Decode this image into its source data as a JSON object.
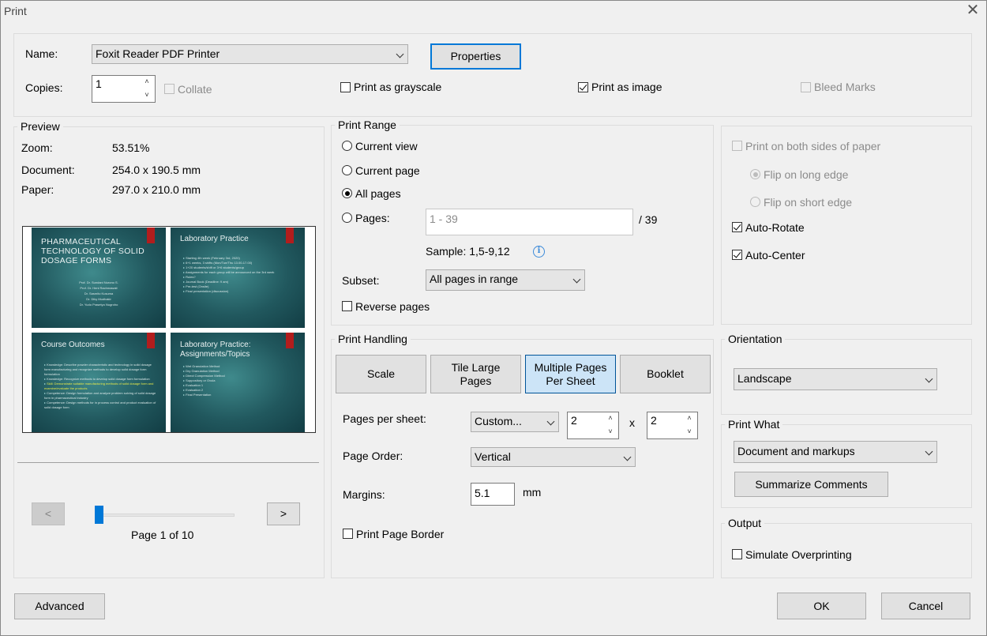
{
  "window": {
    "title": "Print",
    "close_glyph": "✕"
  },
  "printer": {
    "name_label": "Name:",
    "name_value": "Foxit Reader PDF Printer",
    "properties_label": "Properties",
    "copies_label": "Copies:",
    "copies_value": "1",
    "collate_label": "Collate",
    "grayscale_label": "Print as grayscale",
    "as_image_label": "Print as image",
    "bleed_marks_label": "Bleed Marks"
  },
  "preview": {
    "group_label": "Preview",
    "zoom_label": "Zoom:",
    "zoom_value": "53.51%",
    "document_label": "Document:",
    "document_value": "254.0 x 190.5 mm",
    "paper_label": "Paper:",
    "paper_value": "297.0 x 210.0 mm",
    "prev_label": "<",
    "next_label": ">",
    "page_indicator": "Page 1 of 10",
    "slider_position": 0,
    "slides": [
      {
        "title": "PHARMACEUTICAL TECHNOLOGY OF SOLID DOSAGE FORMS",
        "authors": [
          "Prof. Dr. Sundani Nurono S.",
          "Prof. Dr. Heni Rachmawati",
          "Dr. Sasmito Kusuma",
          "Dr. Diky Mudhakir",
          "Dr. Yudo Prasetyo Nugroho"
        ]
      },
      {
        "title": "Laboratory Practice",
        "bullets": [
          "Starting 4th week (February 3rd, 2020)",
          "6+1 weeks, 3 shifts (Mon/Tue/Thu 13.00-17.00)",
          "1+20 students/shift or 3+6 students/group",
          "Assignments for each group will be announced on the 3rd week",
          "Rules?",
          "Journal Book (Deadline: 9 am)",
          "Pre-test (Onsite)",
          "Final presentation (discussion)"
        ]
      },
      {
        "title": "Course Outcomes",
        "bullets": [
          "Knowledge: Describe powder characteristic and technology in solid dosage form manufacturing and recognize methods to develop solid dosage form formulation",
          "Knowledge: Recognize methods to develop solid dosage form formulation",
          "Skill: Demonstrate suitable manufacturing methods of solid dosage form and examine/evaluate the products",
          "Competence: Design formulation and analyze problem solving of solid dosage form in pharmaceutical industry",
          "Competence: Design methods for in process control and product evaluation of solid dosage form"
        ]
      },
      {
        "title": "Laboratory Practice: Assignments/Topics",
        "bullets": [
          "Wet Granulation Method",
          "Dry Granulation Method",
          "Direct Compression Method",
          "Suppository or Ovula",
          "Evaluation 1",
          "Evaluation 2",
          "Final Presentation"
        ]
      }
    ]
  },
  "print_range": {
    "group_label": "Print Range",
    "current_view_label": "Current view",
    "current_page_label": "Current page",
    "all_pages_label": "All pages",
    "pages_label": "Pages:",
    "pages_placeholder": "1 - 39",
    "pages_total": "/ 39",
    "sample_text": "Sample: 1,5-9,12",
    "info_glyph": "i",
    "subset_label": "Subset:",
    "subset_value": "All pages in range",
    "reverse_label": "Reverse pages"
  },
  "print_handling": {
    "group_label": "Print Handling",
    "scale_label": "Scale",
    "tile_label": "Tile Large Pages",
    "multiple_label": "Multiple Pages Per Sheet",
    "booklet_label": "Booklet",
    "pages_per_sheet_label": "Pages per sheet:",
    "pages_per_sheet_value": "Custom...",
    "cols_value": "2",
    "times_glyph": "x",
    "rows_value": "2",
    "page_order_label": "Page Order:",
    "page_order_value": "Vertical",
    "margins_label": "Margins:",
    "margins_value": "5.1",
    "margins_unit": "mm",
    "border_label": "Print Page Border"
  },
  "duplex": {
    "both_sides_label": "Print on both sides of paper",
    "long_edge_label": "Flip on long edge",
    "short_edge_label": "Flip on short edge",
    "auto_rotate_label": "Auto-Rotate",
    "auto_center_label": "Auto-Center"
  },
  "orientation": {
    "group_label": "Orientation",
    "value": "Landscape"
  },
  "print_what": {
    "group_label": "Print What",
    "value": "Document and markups",
    "summarize_label": "Summarize Comments"
  },
  "output": {
    "group_label": "Output",
    "simulate_label": "Simulate Overprinting"
  },
  "footer": {
    "advanced_label": "Advanced",
    "ok_label": "OK",
    "cancel_label": "Cancel"
  },
  "colors": {
    "accent": "#0078d7",
    "selected_button": "#cce4f7",
    "slide_bg": "#21585e",
    "bookmark_red": "#b21d1d"
  }
}
